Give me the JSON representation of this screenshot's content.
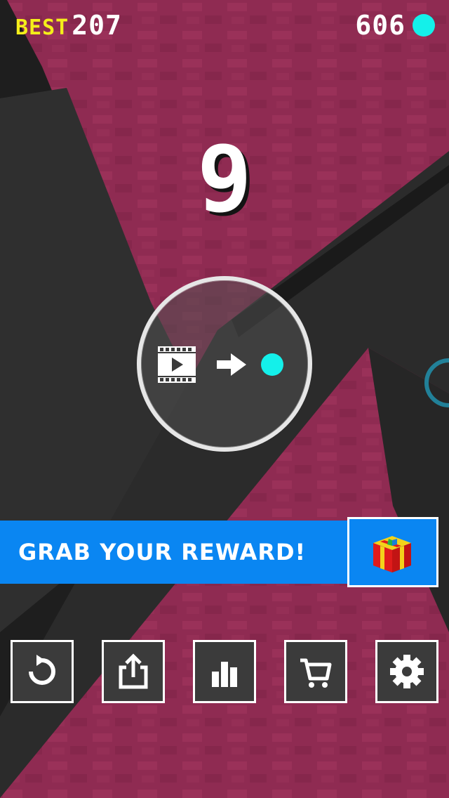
{
  "hud": {
    "best_label": "BEST",
    "best_value": "207",
    "gem_count": "606",
    "gem_color": "#14f0ea"
  },
  "score": "9",
  "video_reward": {
    "icons": [
      "film-icon",
      "arrow-right-icon",
      "gem-icon"
    ]
  },
  "reward_banner": {
    "text": "GRAB YOUR REWARD!",
    "icon": "gift-icon"
  },
  "toolbar": {
    "buttons": [
      {
        "name": "restart",
        "icon": "restart-icon"
      },
      {
        "name": "share",
        "icon": "share-icon"
      },
      {
        "name": "leaderboard",
        "icon": "bar-chart-icon"
      },
      {
        "name": "shop",
        "icon": "cart-icon"
      },
      {
        "name": "settings",
        "icon": "gear-icon"
      }
    ]
  },
  "colors": {
    "background_pink": "#8f2b52",
    "terrain_dark": "#2b2b2b",
    "banner_blue": "#0a86f2",
    "best_yellow": "#f4ee1a"
  }
}
